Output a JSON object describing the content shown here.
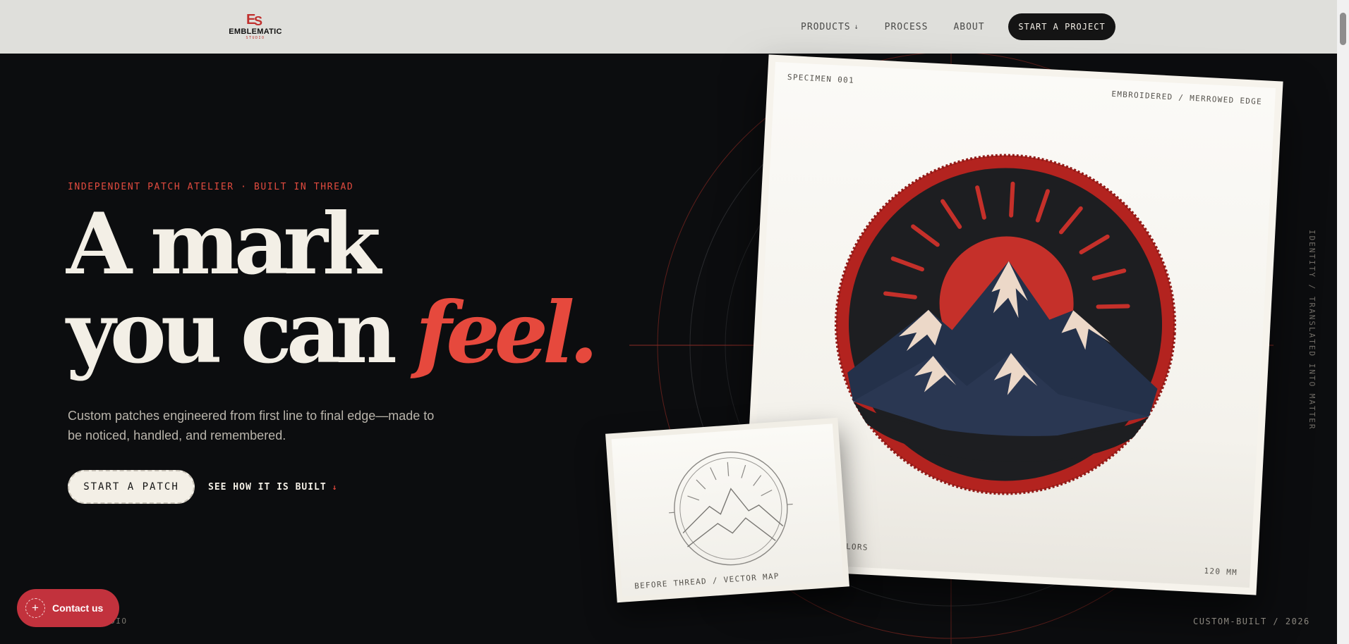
{
  "header": {
    "brand": "EMBLEMATIC",
    "brand_sub": "STUDIO",
    "nav": [
      {
        "label": "PRODUCTS",
        "icon": "chevron-down-icon"
      },
      {
        "label": "PROCESS"
      },
      {
        "label": "ABOUT"
      }
    ],
    "cta": "START A PROJECT"
  },
  "hero": {
    "eyebrow": "INDEPENDENT PATCH ATELIER · BUILT IN THREAD",
    "headline_line1": "A mark",
    "headline_line2": "you can ",
    "headline_accent": "feel.",
    "lede": "Custom patches engineered from first line to final edge—made to be noticed, handled, and remembered.",
    "primary_button": "START A PATCH",
    "secondary_link": "SEE HOW IT IS BUILT",
    "secondary_link_icon": "arrow-down-icon"
  },
  "specimen": {
    "label_tl": "SPECIMEN 001",
    "label_tr": "EMBROIDERED / MERROWED EDGE",
    "label_bl": "COLORS",
    "label_br": "120 MM"
  },
  "sketch": {
    "label": "BEFORE THREAD / VECTOR MAP"
  },
  "side_text": "IDENTITY / TRANSLATED INTO MATTER",
  "footer": {
    "left": "UDIO",
    "right": "CUSTOM-BUILT / 2026"
  },
  "contact": {
    "label": "Contact us",
    "icon": "plus-icon"
  },
  "colors": {
    "accent": "#e6493d",
    "background": "#0c0d0f",
    "cream": "#f3efe6"
  }
}
